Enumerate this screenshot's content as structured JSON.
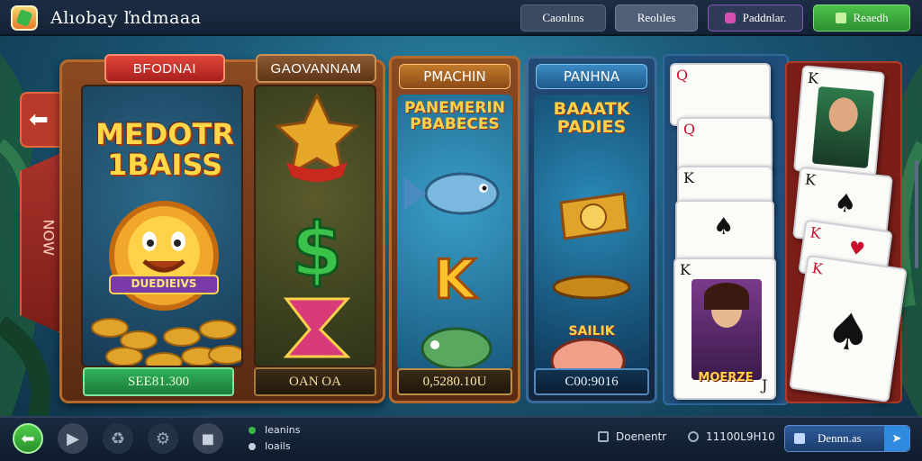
{
  "header": {
    "app_title": "Alıobay ľndmaaa"
  },
  "top_nav": {
    "casinos": "Caonlıns",
    "bonuses": "Reolıles",
    "promos": "Paddnlar.",
    "deposit": "Reaedh"
  },
  "board": {
    "ribbon_left": "BFODNAI",
    "ribbon_right": "GAOVANNAM",
    "headline": "MEDOTR\n1BAISS",
    "mascot_banner": "DUEDIEIVS",
    "payout_left": "SEE81.300",
    "payout_right": "OAN OA",
    "side_tab": "NOW"
  },
  "panels": [
    {
      "title": "PMACHIN",
      "headline": "PANEMERIN PBABECES",
      "payout": "0,5280.10U",
      "symbol_letter": "K"
    },
    {
      "title": "PANHNA",
      "headline": "BAAATK PADIES",
      "subtitle": "SAILIK",
      "payout": "C00:9016"
    }
  ],
  "cards": {
    "left_face_label": "MOERZE",
    "corner_q": "Q",
    "corner_k": "K",
    "corner_j": "J"
  },
  "bottom": {
    "legend1": "Ieanins",
    "legend2": "Ioails",
    "docs": "Doenentr",
    "credit": "11100L9H10",
    "demo": "Dennn.as"
  },
  "colors": {
    "accent_green": "#3ab54a",
    "accent_red": "#c8102e",
    "panel_blue": "#1f5a8c",
    "wood": "#8a4a22"
  },
  "icons": [
    "back-arrow-icon",
    "play-icon",
    "reload-icon",
    "settings-gear-icon",
    "camera-icon",
    "document-icon",
    "credit-icon",
    "share-icon"
  ]
}
